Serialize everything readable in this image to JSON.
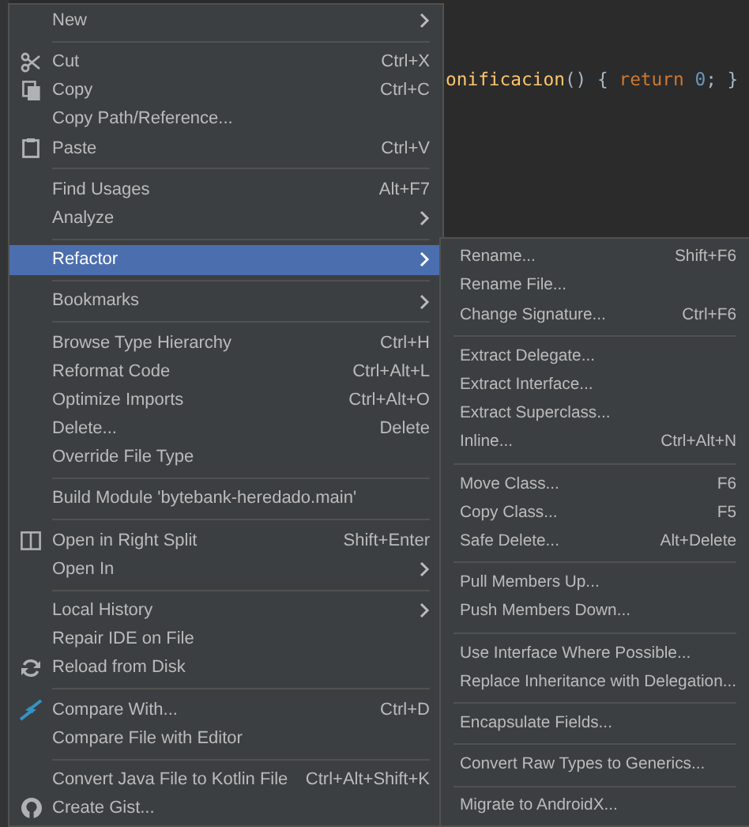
{
  "editor": {
    "code_parts": [
      {
        "kind": "method",
        "text": "onificacion"
      },
      {
        "kind": "plain",
        "text": "() {"
      },
      {
        "kind": "keyword",
        "text": "return"
      },
      {
        "kind": "number",
        "text": "0"
      },
      {
        "kind": "plain",
        "text": "; }"
      }
    ]
  },
  "context_menu": [
    {
      "kind": "item",
      "label": "New",
      "submenu": true,
      "selected": false
    },
    {
      "kind": "separator"
    },
    {
      "kind": "item",
      "label": "Cut",
      "shortcut": "Ctrl+X",
      "submenu": false,
      "selected": false
    },
    {
      "kind": "item",
      "label": "Copy",
      "shortcut": "Ctrl+C",
      "submenu": false,
      "selected": false
    },
    {
      "kind": "item",
      "label": "Copy Path/Reference...",
      "submenu": false,
      "selected": false
    },
    {
      "kind": "item",
      "label": "Paste",
      "shortcut": "Ctrl+V",
      "submenu": false,
      "selected": false
    },
    {
      "kind": "separator"
    },
    {
      "kind": "item",
      "label": "Find Usages",
      "shortcut": "Alt+F7",
      "submenu": false,
      "selected": false
    },
    {
      "kind": "item",
      "label": "Analyze",
      "submenu": true,
      "selected": false
    },
    {
      "kind": "separator"
    },
    {
      "kind": "item",
      "label": "Refactor",
      "submenu": true,
      "selected": true
    },
    {
      "kind": "separator"
    },
    {
      "kind": "item",
      "label": "Bookmarks",
      "submenu": true,
      "selected": false
    },
    {
      "kind": "separator"
    },
    {
      "kind": "item",
      "label": "Browse Type Hierarchy",
      "shortcut": "Ctrl+H",
      "submenu": false,
      "selected": false
    },
    {
      "kind": "item",
      "label": "Reformat Code",
      "shortcut": "Ctrl+Alt+L",
      "submenu": false,
      "selected": false
    },
    {
      "kind": "item",
      "label": "Optimize Imports",
      "shortcut": "Ctrl+Alt+O",
      "submenu": false,
      "selected": false
    },
    {
      "kind": "item",
      "label": "Delete...",
      "shortcut": "Delete",
      "submenu": false,
      "selected": false
    },
    {
      "kind": "item",
      "label": "Override File Type",
      "submenu": false,
      "selected": false
    },
    {
      "kind": "separator"
    },
    {
      "kind": "item",
      "label": "Build Module 'bytebank-heredado.main'",
      "submenu": false,
      "selected": false
    },
    {
      "kind": "separator"
    },
    {
      "kind": "item",
      "label": "Open in Right Split",
      "shortcut": "Shift+Enter",
      "submenu": false,
      "selected": false
    },
    {
      "kind": "item",
      "label": "Open In",
      "submenu": true,
      "selected": false
    },
    {
      "kind": "separator"
    },
    {
      "kind": "item",
      "label": "Local History",
      "submenu": true,
      "selected": false
    },
    {
      "kind": "item",
      "label": "Repair IDE on File",
      "submenu": false,
      "selected": false
    },
    {
      "kind": "item",
      "label": "Reload from Disk",
      "submenu": false,
      "selected": false
    },
    {
      "kind": "separator"
    },
    {
      "kind": "item",
      "label": "Compare With...",
      "shortcut": "Ctrl+D",
      "submenu": false,
      "selected": false
    },
    {
      "kind": "item",
      "label": "Compare File with Editor",
      "submenu": false,
      "selected": false
    },
    {
      "kind": "separator"
    },
    {
      "kind": "item",
      "label": "Convert Java File to Kotlin File",
      "shortcut": "Ctrl+Alt+Shift+K",
      "submenu": false,
      "selected": false
    },
    {
      "kind": "item",
      "label": "Create Gist...",
      "submenu": false,
      "selected": false
    }
  ],
  "refactor_submenu": [
    {
      "kind": "item",
      "label": "Rename...",
      "shortcut": "Shift+F6"
    },
    {
      "kind": "item",
      "label": "Rename File..."
    },
    {
      "kind": "item",
      "label": "Change Signature...",
      "shortcut": "Ctrl+F6"
    },
    {
      "kind": "separator"
    },
    {
      "kind": "item",
      "label": "Extract Delegate..."
    },
    {
      "kind": "item",
      "label": "Extract Interface..."
    },
    {
      "kind": "item",
      "label": "Extract Superclass..."
    },
    {
      "kind": "item",
      "label": "Inline...",
      "shortcut": "Ctrl+Alt+N"
    },
    {
      "kind": "separator"
    },
    {
      "kind": "item",
      "label": "Move Class...",
      "shortcut": "F6"
    },
    {
      "kind": "item",
      "label": "Copy Class...",
      "shortcut": "F5"
    },
    {
      "kind": "item",
      "label": "Safe Delete...",
      "shortcut": "Alt+Delete"
    },
    {
      "kind": "separator"
    },
    {
      "kind": "item",
      "label": "Pull Members Up..."
    },
    {
      "kind": "item",
      "label": "Push Members Down..."
    },
    {
      "kind": "separator"
    },
    {
      "kind": "item",
      "label": "Use Interface Where Possible..."
    },
    {
      "kind": "item",
      "label": "Replace Inheritance with Delegation..."
    },
    {
      "kind": "separator"
    },
    {
      "kind": "item",
      "label": "Encapsulate Fields..."
    },
    {
      "kind": "separator"
    },
    {
      "kind": "item",
      "label": "Convert Raw Types to Generics..."
    },
    {
      "kind": "separator"
    },
    {
      "kind": "item",
      "label": "Migrate to AndroidX..."
    }
  ]
}
